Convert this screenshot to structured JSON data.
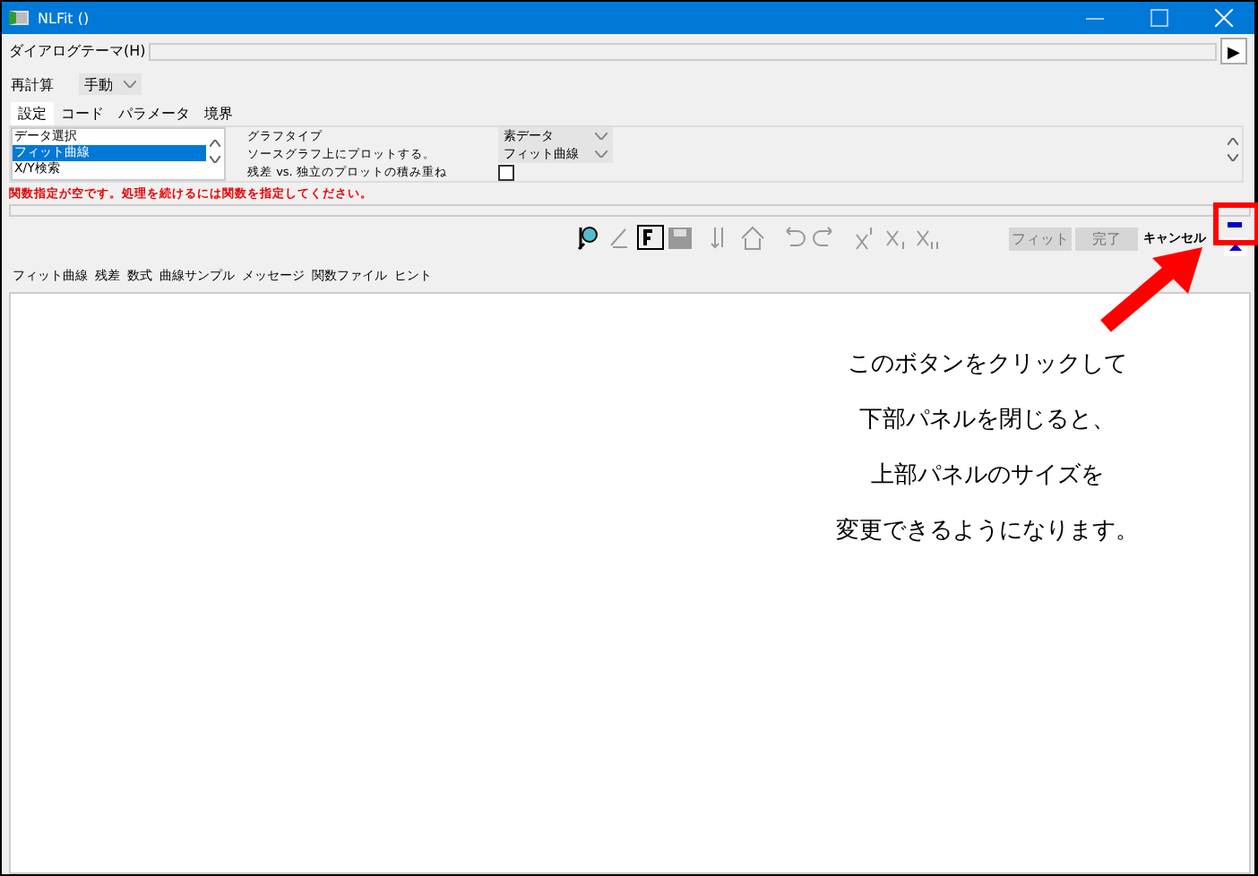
{
  "window": {
    "title": "NLFit ()"
  },
  "theme_bar": {
    "label": "ダイアログテーマ(H)",
    "button": "▶"
  },
  "recalculate": {
    "label": "再計算",
    "value": "手動"
  },
  "tabs": [
    {
      "label": "設定",
      "selected": true
    },
    {
      "label": "コード",
      "selected": false
    },
    {
      "label": "パラメータ",
      "selected": false
    },
    {
      "label": "境界",
      "selected": false
    }
  ],
  "settings_list": [
    {
      "label": "データ選択",
      "selected": false
    },
    {
      "label": "フィット曲線",
      "selected": true
    },
    {
      "label": "X/Y検索",
      "selected": false
    }
  ],
  "settings": [
    {
      "label": "グラフタイプ",
      "kind": "dropdown",
      "value": "素データ"
    },
    {
      "label": "ソースグラフ上にプロットする。",
      "kind": "dropdown",
      "value": "フィット曲線"
    },
    {
      "label": "残差 vs. 独立のプロットの積み重ね",
      "kind": "checkbox",
      "checked": false
    }
  ],
  "message": "関数指定が空です。処理を続けるには関数を指定してください。",
  "buttons": [
    {
      "label": "フィット",
      "disabled": true
    },
    {
      "label": "完了",
      "disabled": true
    },
    {
      "label": "キャンセル",
      "disabled": false
    }
  ],
  "bottom_tabs": [
    "フィット曲線",
    "残差",
    "数式",
    "曲線サンプル",
    "メッセージ",
    "関数ファイル",
    "ヒント"
  ],
  "annotation": [
    "このボタンをクリックして",
    "下部パネルを閉じると、",
    "上部パネルのサイズを",
    "変更できるようになります。"
  ]
}
